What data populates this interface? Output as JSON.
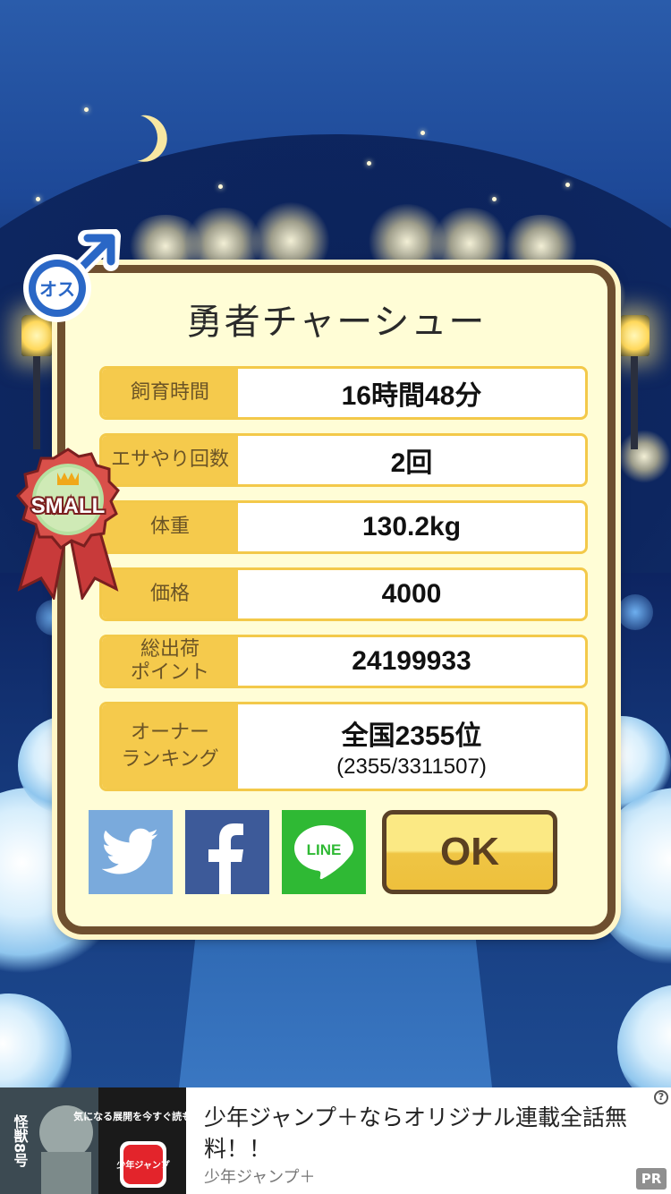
{
  "dialog": {
    "title": "勇者チャーシュー",
    "rows": [
      {
        "label": "飼育時間",
        "value": "16時間48分"
      },
      {
        "label": "エサやり回数",
        "value": "2回"
      },
      {
        "label": "体重",
        "value": "130.2kg"
      },
      {
        "label": "価格",
        "value": "4000"
      },
      {
        "label_line1": "総出荷",
        "label_line2": "ポイント",
        "value": "24199933"
      },
      {
        "label_line1": "オーナー",
        "label_line2": "ランキング",
        "value": "全国2355位",
        "sub_value": "(2355/3311507)"
      }
    ],
    "ok_label": "OK",
    "share": {
      "line_label": "LINE"
    }
  },
  "gender_badge": {
    "label": "オス",
    "icon": "male-symbol-icon"
  },
  "size_ribbon": {
    "label": "SMALL",
    "icon": "crown-icon"
  },
  "ad": {
    "title": "少年ジャンプ＋ならオリジナル連載全話無料！！",
    "advertiser": "少年ジャンプ＋",
    "pr_label": "PR",
    "info_label": "?",
    "image": {
      "title_text": "怪獣8号",
      "caption": "気になる展開を今すぐ読もう！",
      "logo_text": "少年ジャンプ"
    }
  },
  "colors": {
    "label_bg": "#f5ca4c",
    "dialog_bg": "#fffdd6",
    "dialog_border": "#6e4f2f",
    "twitter": "#7aaadc",
    "facebook": "#3d5a99",
    "line": "#2fb934",
    "ok_button": "#f3d157"
  }
}
